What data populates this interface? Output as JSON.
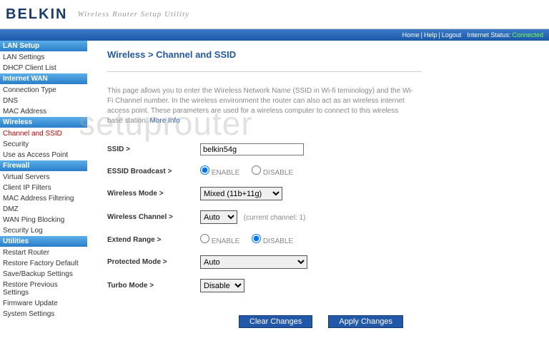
{
  "brand": "BELKIN",
  "tagline": "Wireless Router Setup Utility",
  "topnav": {
    "home": "Home",
    "help": "Help",
    "logout": "Logout",
    "status_label": "Internet Status:",
    "status_value": "Connected"
  },
  "sidebar": {
    "cats": [
      {
        "name": "LAN Setup",
        "items": [
          "LAN Settings",
          "DHCP Client List"
        ]
      },
      {
        "name": "Internet WAN",
        "items": [
          "Connection Type",
          "DNS",
          "MAC Address"
        ]
      },
      {
        "name": "Wireless",
        "items": [
          "Channel and SSID",
          "Security",
          "Use as Access Point"
        ]
      },
      {
        "name": "Firewall",
        "items": [
          "Virtual Servers",
          "Client IP Filters",
          "MAC Address Filtering",
          "DMZ",
          "WAN Ping Blocking",
          "Security Log"
        ]
      },
      {
        "name": "Utilities",
        "items": [
          "Restart Router",
          "Restore Factory Default",
          "Save/Backup Settings",
          "Restore Previous Settings",
          "Firmware Update",
          "System Settings"
        ]
      }
    ]
  },
  "page": {
    "title": "Wireless > Channel and SSID",
    "desc": "This page allows you to enter the Wireless Network Name (SSID in Wi-fi teminology) and the Wi-Fi Channel number. In the wireless environment the router can also act as an wireless internet access point. These parameters are used for a wireless computer to connect to this wireless base station.",
    "more": "More Info"
  },
  "form": {
    "ssid_label": "SSID >",
    "ssid_value": "belkin54g",
    "essid_label": "ESSID Broadcast >",
    "enable": "ENABLE",
    "disable": "DISABLE",
    "mode_label": "Wireless Mode >",
    "mode_value": "Mixed (11b+11g)",
    "channel_label": "Wireless Channel >",
    "channel_value": "Auto",
    "current_channel": "(current channel: 1)",
    "extend_label": "Extend Range >",
    "protected_label": "Protected Mode >",
    "protected_value": "Auto",
    "turbo_label": "Turbo Mode >",
    "turbo_value": "Disable"
  },
  "buttons": {
    "clear": "Clear Changes",
    "apply": "Apply Changes"
  },
  "watermark": "setuprouter"
}
